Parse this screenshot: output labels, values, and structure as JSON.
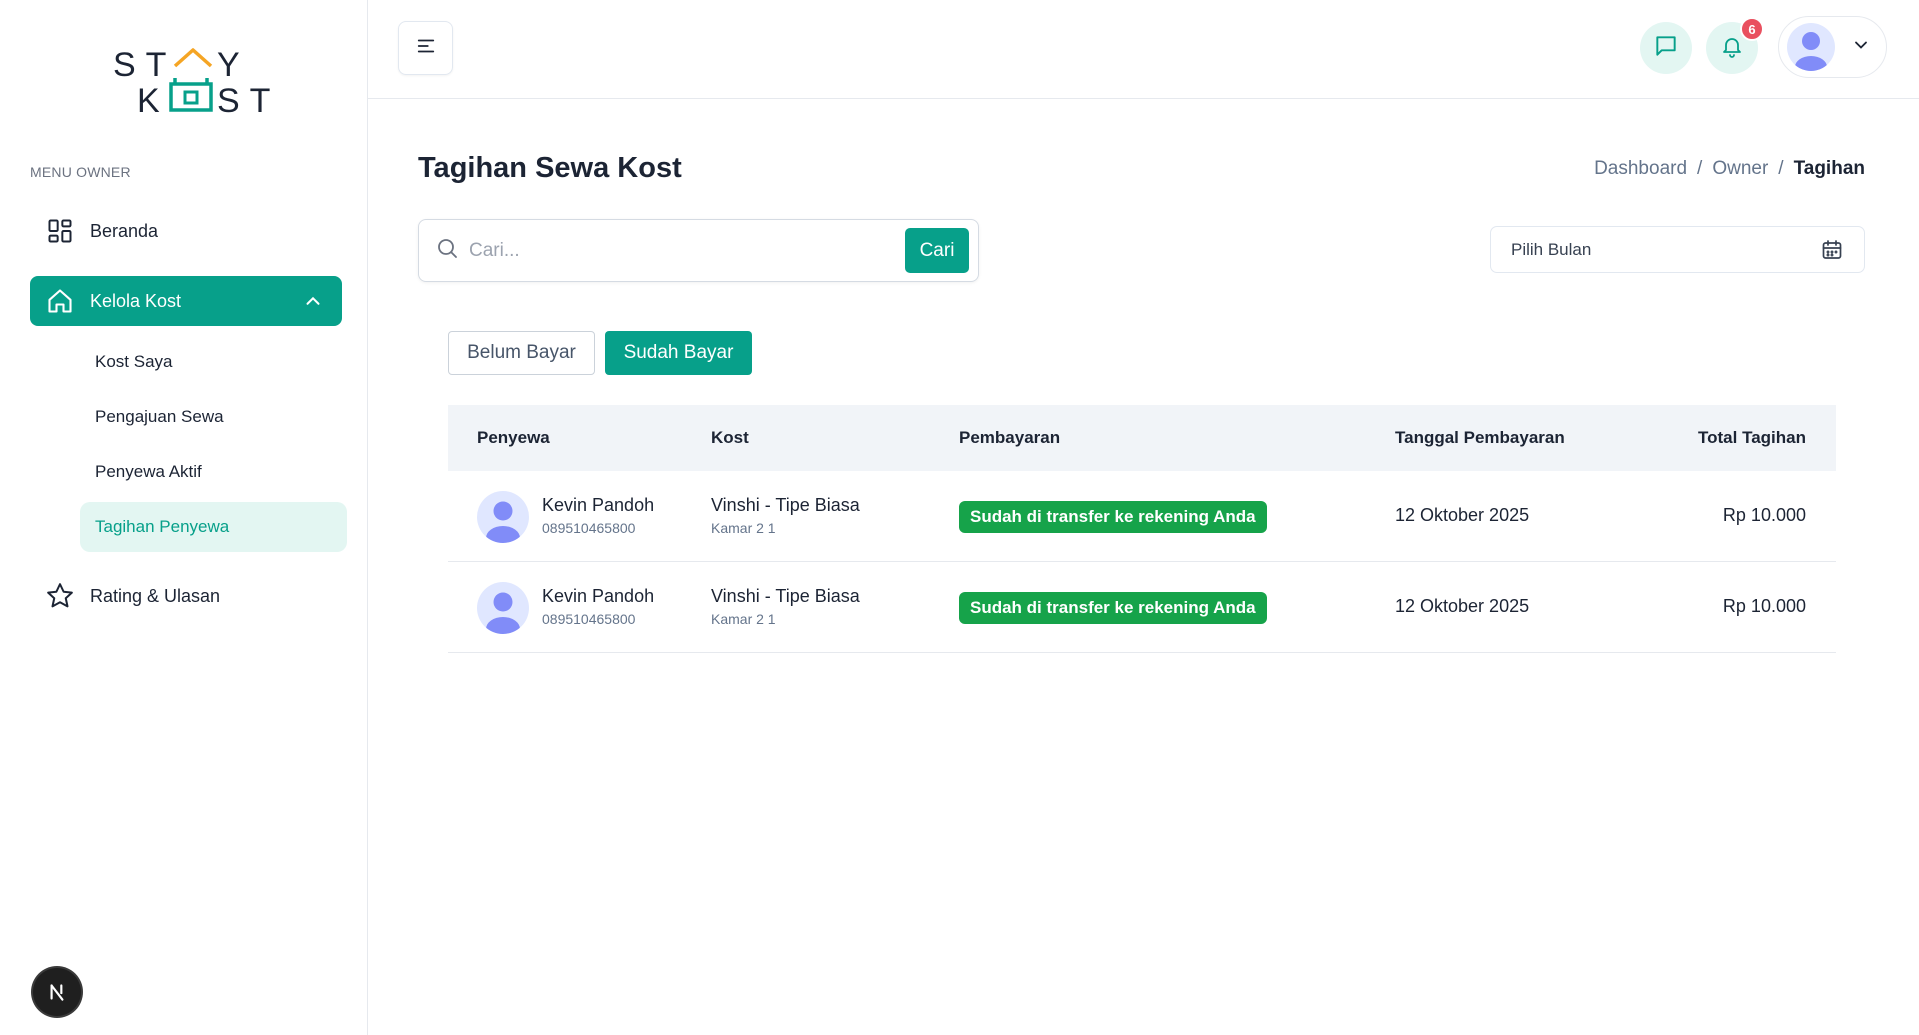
{
  "brand": {
    "logo_line1": "ST Y",
    "logo_line2": "K ST",
    "accent": "#07a08a",
    "roof_color": "#f5a524"
  },
  "sidebar": {
    "menu_title": "MENU OWNER",
    "items": [
      {
        "label": "Beranda",
        "icon": "grid-icon"
      },
      {
        "label": "Kelola Kost",
        "icon": "home-icon",
        "expanded": true
      },
      {
        "label": "Rating & Ulasan",
        "icon": "star-icon"
      }
    ],
    "sub_items": [
      {
        "label": "Kost Saya"
      },
      {
        "label": "Pengajuan Sewa"
      },
      {
        "label": "Penyewa Aktif"
      },
      {
        "label": "Tagihan Penyewa",
        "active": true
      }
    ]
  },
  "header": {
    "notification_count": "6"
  },
  "page": {
    "title": "Tagihan Sewa Kost",
    "breadcrumb": [
      "Dashboard",
      "Owner",
      "Tagihan"
    ],
    "search_placeholder": "Cari...",
    "search_button": "Cari",
    "month_placeholder": "Pilih Bulan",
    "tabs": [
      {
        "label": "Belum Bayar",
        "active": false
      },
      {
        "label": "Sudah Bayar",
        "active": true
      }
    ]
  },
  "table": {
    "headers": [
      "Penyewa",
      "Kost",
      "Pembayaran",
      "Tanggal Pembayaran",
      "Total Tagihan"
    ],
    "rows": [
      {
        "name": "Kevin Pandoh",
        "phone": "089510465800",
        "kost": "Vinshi - Tipe Biasa",
        "room": "Kamar 2 1",
        "status": "Sudah di transfer ke rekening Anda",
        "date": "12 Oktober 2025",
        "total": "Rp 10.000"
      },
      {
        "name": "Kevin Pandoh",
        "phone": "089510465800",
        "kost": "Vinshi - Tipe Biasa",
        "room": "Kamar 2 1",
        "status": "Sudah di transfer ke rekening Anda",
        "date": "12 Oktober 2025",
        "total": "Rp 10.000"
      }
    ]
  }
}
